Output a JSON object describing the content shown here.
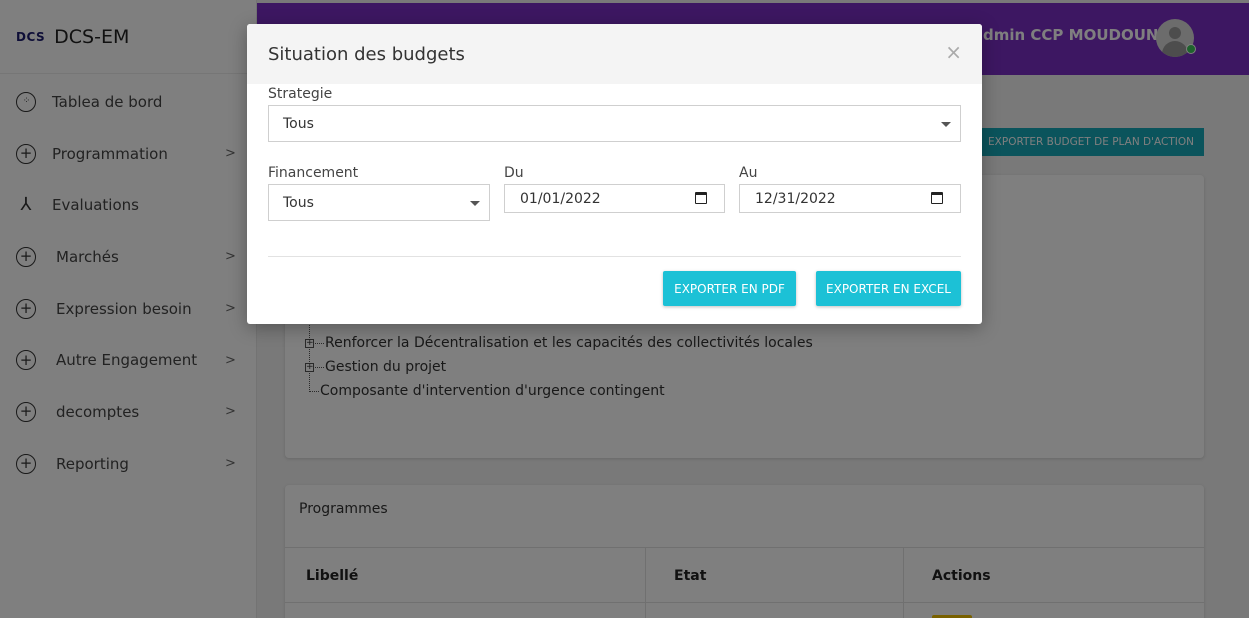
{
  "brand": {
    "logo": "DCS",
    "name": "DCS-EM"
  },
  "sidebar": {
    "items": [
      {
        "label": "Tablea de bord",
        "icon": "dashboard-icon",
        "chevron": false
      },
      {
        "label": "Programmation",
        "icon": "plus-circle-icon",
        "chevron": true
      },
      {
        "label": "Evaluations",
        "icon": "walk-icon",
        "chevron": false
      },
      {
        "label": "Marchés",
        "icon": "plus-circle-icon",
        "chevron": true
      },
      {
        "label": "Expression besoin",
        "icon": "plus-circle-icon",
        "chevron": true
      },
      {
        "label": "Autre Engagement",
        "icon": "plus-circle-icon",
        "chevron": true
      },
      {
        "label": "decomptes",
        "icon": "plus-circle-icon",
        "chevron": true
      },
      {
        "label": "Reporting",
        "icon": "plus-circle-icon",
        "chevron": true
      }
    ]
  },
  "header": {
    "user_name": "dmin CCP MOUDOUN",
    "online": true
  },
  "toolbar": {
    "export_plan_label": "EXPORTER BUDGET DE PLAN D'ACTION"
  },
  "tree": {
    "items": [
      "Renforcer la Décentralisation et les capacités des collectivités locales",
      "Gestion du projet",
      "Composante d'intervention d'urgence contingent"
    ]
  },
  "programmes": {
    "title": "Programmes",
    "columns": [
      "Libellé",
      "Etat",
      "Actions"
    ]
  },
  "modal": {
    "title": "Situation des budgets",
    "close_glyph": "×",
    "strategie": {
      "label": "Strategie",
      "value": "Tous"
    },
    "financement": {
      "label": "Financement",
      "value": "Tous"
    },
    "du": {
      "label": "Du",
      "value": "01/01/2022"
    },
    "au": {
      "label": "Au",
      "value": "12/31/2022"
    },
    "export_pdf_label": "EXPORTER EN PDF",
    "export_excel_label": "EXPORTER EN EXCEL"
  },
  "colors": {
    "header_bg": "#7b2fc4",
    "accent_button": "#1cc1d6",
    "plan_button": "#17a8b8",
    "online": "#3ec45a"
  }
}
